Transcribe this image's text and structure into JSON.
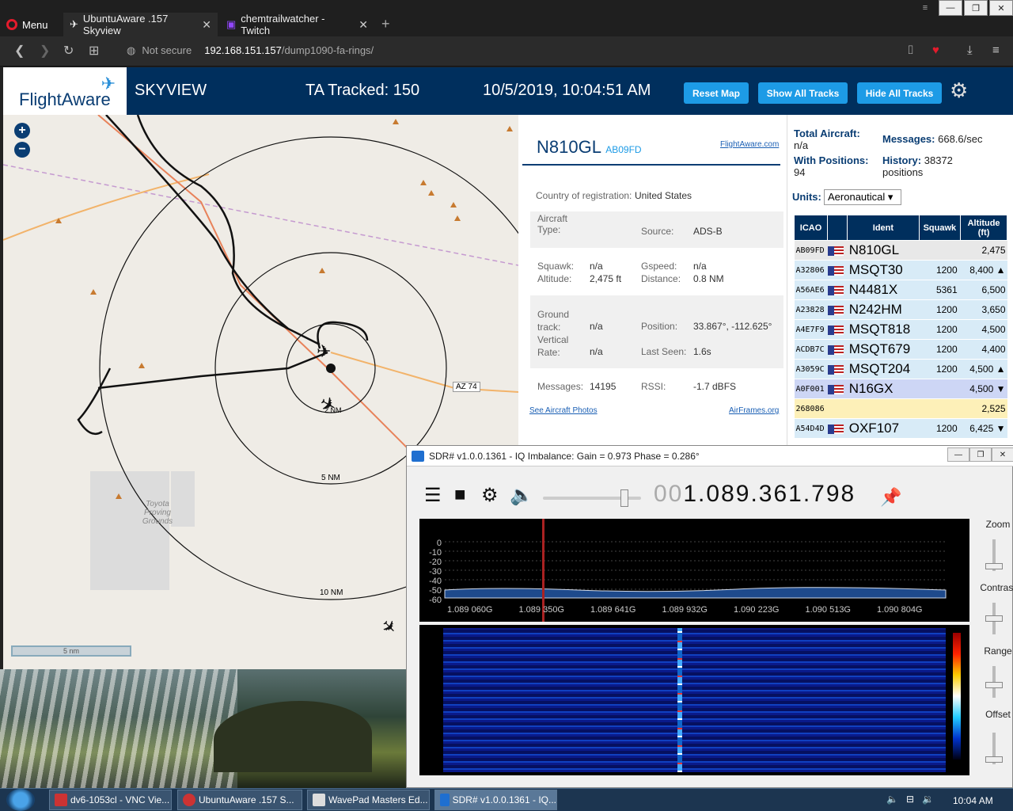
{
  "browser": {
    "menu_label": "Menu",
    "tabs": [
      {
        "title": "UbuntuAware .157 Skyview",
        "icon": "plane-icon"
      },
      {
        "title": "chemtrailwatcher - Twitch",
        "icon": "twitch-icon"
      }
    ],
    "security": "Not secure",
    "url_host": "192.168.151.157",
    "url_path": "/dump1090-fa-rings/"
  },
  "header": {
    "logo": "FlightAware",
    "app": "SKYVIEW",
    "tracked": "TA Tracked: 150",
    "datetime": "10/5/2019, 10:04:51 AM",
    "buttons": [
      "Reset Map",
      "Show All Tracks",
      "Hide All Tracks"
    ]
  },
  "map": {
    "zoom_in": "+",
    "zoom_out": "−",
    "road_label": "AZ 74",
    "ring_labels": [
      "5 NM",
      "10 NM",
      "2 NM"
    ],
    "place_label": "Toyota Proving Grounds",
    "scale_label": "5 nm"
  },
  "aircraft": {
    "registration": "N810GL",
    "hex": "AB09FD",
    "fa_link": "FlightAware.com",
    "country_label": "Country of registration:",
    "country": "United States",
    "type_label": "Aircraft Type:",
    "source_label": "Source:",
    "source": "ADS-B",
    "squawk_label": "Squawk:",
    "squawk": "n/a",
    "altitude_label": "Altitude:",
    "altitude": "2,475 ft",
    "gspeed_label": "Gspeed:",
    "gspeed": "n/a",
    "distance_label": "Distance:",
    "distance": "0.8 NM",
    "track_label": "Ground track:",
    "track": "n/a",
    "vrate_label": "Vertical Rate:",
    "vrate": "n/a",
    "position_label": "Position:",
    "position": "33.867°, -112.625°",
    "lastseen_label": "Last Seen:",
    "lastseen": "1.6s",
    "messages_label": "Messages:",
    "messages": "14195",
    "rssi_label": "RSSI:",
    "rssi": "-1.7 dBFS",
    "photos_link": "See Aircraft Photos",
    "airframes_link": "AirFrames.org"
  },
  "stats": {
    "total_label": "Total Aircraft:",
    "total": "n/a",
    "withpos_label": "With Positions:",
    "withpos": "94",
    "messages_label": "Messages:",
    "messages": "668.6/sec",
    "history_label": "History:",
    "history": "38372 positions",
    "units_label": "Units:",
    "units": "Aeronautical"
  },
  "table": {
    "headers": [
      "ICAO",
      "",
      "Ident",
      "Squawk",
      "Altitude (ft)"
    ],
    "rows": [
      {
        "icao": "AB09FD",
        "ident": "N810GL",
        "squawk": "",
        "alt": "2,475",
        "bg": "#e8e8e8"
      },
      {
        "icao": "A32806",
        "ident": "MSQT30",
        "squawk": "1200",
        "alt": "8,400 ▲",
        "bg": "#d8ebf7"
      },
      {
        "icao": "A56AE6",
        "ident": "N4481X",
        "squawk": "5361",
        "alt": "6,500",
        "bg": "#d8ebf7"
      },
      {
        "icao": "A23828",
        "ident": "N242HM",
        "squawk": "1200",
        "alt": "3,650",
        "bg": "#d8ebf7"
      },
      {
        "icao": "A4E7F9",
        "ident": "MSQT818",
        "squawk": "1200",
        "alt": "4,500",
        "bg": "#d8ebf7"
      },
      {
        "icao": "ACDB7C",
        "ident": "MSQT679",
        "squawk": "1200",
        "alt": "4,400",
        "bg": "#d8ebf7"
      },
      {
        "icao": "A3059C",
        "ident": "MSQT204",
        "squawk": "1200",
        "alt": "4,500 ▲",
        "bg": "#d8ebf7"
      },
      {
        "icao": "A0F001",
        "ident": "N16GX",
        "squawk": "",
        "alt": "4,500 ▼",
        "bg": "#cdd6f5"
      },
      {
        "icao": "268086",
        "ident": "",
        "squawk": "",
        "alt": "2,525",
        "bg": "#fdf0b8"
      },
      {
        "icao": "A54D4D",
        "ident": "OXF107",
        "squawk": "1200",
        "alt": "6,425 ▼",
        "bg": "#d8ebf7"
      }
    ]
  },
  "sdr": {
    "title": "SDR# v1.0.0.1361 - IQ Imbalance: Gain = 0.973 Phase = 0.286°",
    "freq_dim": "00",
    "freq": "1.089.361.798",
    "db_ticks": [
      "0",
      "-10",
      "-20",
      "-30",
      "-40",
      "-50",
      "-60"
    ],
    "freq_ticks": [
      "1.089 060G",
      "1.089 350G",
      "1.089 641G",
      "1.089 932G",
      "1.090 223G",
      "1.090 513G",
      "1.090 804G"
    ],
    "side_labels": [
      "Zoom",
      "Contrast",
      "Range",
      "Offset"
    ]
  },
  "taskbar": {
    "items": [
      "dv6-1053cl - VNC Vie...",
      "UbuntuAware .157 S...",
      "WavePad Masters Ed...",
      "SDR# v1.0.0.1361 - IQ..."
    ],
    "clock": "10:04 AM"
  }
}
